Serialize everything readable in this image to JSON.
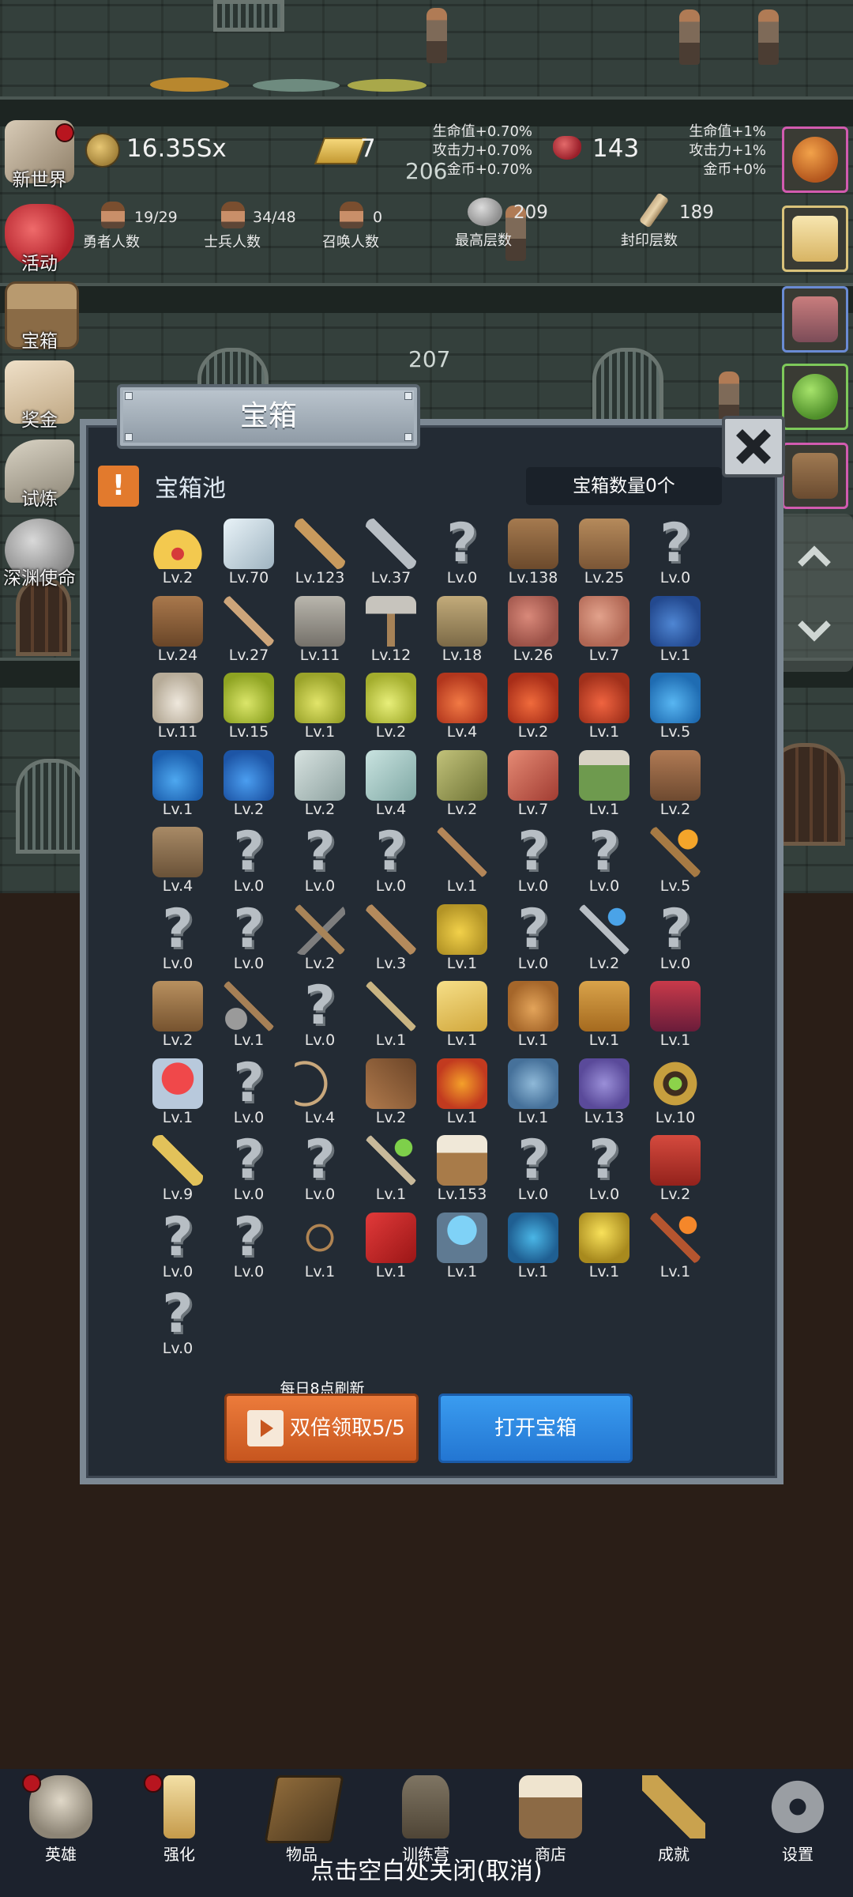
{
  "top_stats": {
    "coins": "16.35Sx",
    "gold_bars": "7",
    "rubies": "143",
    "bonus_left": [
      "生命值+0.70%",
      "攻击力+0.70%",
      "金币+0.70%"
    ],
    "bonus_right": [
      "生命值+1%",
      "攻击力+1%",
      "金币+0%"
    ],
    "heroes": {
      "value": "19/29",
      "label": "勇者人数"
    },
    "soldiers": {
      "value": "34/48",
      "label": "士兵人数"
    },
    "summons": {
      "value": "0",
      "label": "召唤人数"
    },
    "highest_floor": {
      "value": "209",
      "label": "最高层数"
    },
    "sealed_floor": {
      "value": "189",
      "label": "封印层数"
    }
  },
  "floor_numbers": [
    "206",
    "207"
  ],
  "sidebar": {
    "items": [
      {
        "label": "新世界",
        "badge": true
      },
      {
        "label": "活动",
        "badge": false
      },
      {
        "label": "宝箱",
        "badge": false
      },
      {
        "label": "奖金",
        "badge": false
      },
      {
        "label": "试炼",
        "badge": false
      },
      {
        "label": "深渊使命",
        "badge": false
      }
    ]
  },
  "modal": {
    "title": "宝箱",
    "pool_icon": "!",
    "pool_title": "宝箱池",
    "chest_count": "宝箱数量0个",
    "refresh_note": "每日8点刷新",
    "double_claim": "双倍领取5/5",
    "open_chest": "打开宝箱",
    "items": [
      {
        "icon": "crown",
        "lv": "Lv.2"
      },
      {
        "icon": "diamond",
        "lv": "Lv.70"
      },
      {
        "icon": "wood-sword",
        "lv": "Lv.123"
      },
      {
        "icon": "iron-sword",
        "lv": "Lv.37"
      },
      {
        "icon": "unknown",
        "lv": "Lv.0"
      },
      {
        "icon": "leather-armor",
        "lv": "Lv.138"
      },
      {
        "icon": "backpack",
        "lv": "Lv.25"
      },
      {
        "icon": "unknown",
        "lv": "Lv.0"
      },
      {
        "icon": "leather-helmet",
        "lv": "Lv.24"
      },
      {
        "icon": "dagger",
        "lv": "Lv.27"
      },
      {
        "icon": "knight-helmet",
        "lv": "Lv.11"
      },
      {
        "icon": "hammer",
        "lv": "Lv.12"
      },
      {
        "icon": "great-helm",
        "lv": "Lv.18"
      },
      {
        "icon": "ham",
        "lv": "Lv.26"
      },
      {
        "icon": "steak",
        "lv": "Lv.7"
      },
      {
        "icon": "blue-sack",
        "lv": "Lv.1"
      },
      {
        "icon": "flour",
        "lv": "Lv.11"
      },
      {
        "icon": "yellow-potion",
        "lv": "Lv.15"
      },
      {
        "icon": "yellow-flask",
        "lv": "Lv.1"
      },
      {
        "icon": "yellow-round-potion",
        "lv": "Lv.2"
      },
      {
        "icon": "red-potion",
        "lv": "Lv.4"
      },
      {
        "icon": "red-flask",
        "lv": "Lv.2"
      },
      {
        "icon": "red-round-potion",
        "lv": "Lv.1"
      },
      {
        "icon": "blue-potion",
        "lv": "Lv.5"
      },
      {
        "icon": "blue-flask",
        "lv": "Lv.1"
      },
      {
        "icon": "blue-round-potion",
        "lv": "Lv.2"
      },
      {
        "icon": "white-vial",
        "lv": "Lv.2"
      },
      {
        "icon": "clear-vial",
        "lv": "Lv.4"
      },
      {
        "icon": "green-bottle",
        "lv": "Lv.2"
      },
      {
        "icon": "red-bottle",
        "lv": "Lv.7"
      },
      {
        "icon": "winged-boot",
        "lv": "Lv.1"
      },
      {
        "icon": "leather-boot",
        "lv": "Lv.2"
      },
      {
        "icon": "shoe",
        "lv": "Lv.4"
      },
      {
        "icon": "unknown",
        "lv": "Lv.0"
      },
      {
        "icon": "unknown",
        "lv": "Lv.0"
      },
      {
        "icon": "unknown",
        "lv": "Lv.0"
      },
      {
        "icon": "stick",
        "lv": "Lv.1"
      },
      {
        "icon": "unknown",
        "lv": "Lv.0"
      },
      {
        "icon": "unknown",
        "lv": "Lv.0"
      },
      {
        "icon": "torch",
        "lv": "Lv.5"
      },
      {
        "icon": "unknown",
        "lv": "Lv.0"
      },
      {
        "icon": "unknown",
        "lv": "Lv.0"
      },
      {
        "icon": "pickaxe",
        "lv": "Lv.2"
      },
      {
        "icon": "staff",
        "lv": "Lv.3"
      },
      {
        "icon": "lemons",
        "lv": "Lv.1"
      },
      {
        "icon": "unknown",
        "lv": "Lv.0"
      },
      {
        "icon": "blue-wand",
        "lv": "Lv.2"
      },
      {
        "icon": "unknown",
        "lv": "Lv.0"
      },
      {
        "icon": "big-backpack",
        "lv": "Lv.2"
      },
      {
        "icon": "shovel",
        "lv": "Lv.1"
      },
      {
        "icon": "unknown",
        "lv": "Lv.0"
      },
      {
        "icon": "broom",
        "lv": "Lv.1"
      },
      {
        "icon": "cheese",
        "lv": "Lv.1"
      },
      {
        "icon": "pie",
        "lv": "Lv.1"
      },
      {
        "icon": "honey-jar",
        "lv": "Lv.1"
      },
      {
        "icon": "red-crystal",
        "lv": "Lv.1"
      },
      {
        "icon": "red-orb",
        "lv": "Lv.1"
      },
      {
        "icon": "unknown",
        "lv": "Lv.0"
      },
      {
        "icon": "bow",
        "lv": "Lv.4"
      },
      {
        "icon": "quiver",
        "lv": "Lv.2"
      },
      {
        "icon": "fire-scroll",
        "lv": "Lv.1"
      },
      {
        "icon": "blue-spirit",
        "lv": "Lv.1"
      },
      {
        "icon": "purple-spirit",
        "lv": "Lv.13"
      },
      {
        "icon": "green-eye-ring",
        "lv": "Lv.10"
      },
      {
        "icon": "gold-wand",
        "lv": "Lv.9"
      },
      {
        "icon": "unknown",
        "lv": "Lv.0"
      },
      {
        "icon": "unknown",
        "lv": "Lv.0"
      },
      {
        "icon": "green-wand",
        "lv": "Lv.1"
      },
      {
        "icon": "beer-mug",
        "lv": "Lv.153"
      },
      {
        "icon": "unknown",
        "lv": "Lv.0"
      },
      {
        "icon": "unknown",
        "lv": "Lv.0"
      },
      {
        "icon": "red-book",
        "lv": "Lv.2"
      },
      {
        "icon": "unknown",
        "lv": "Lv.0"
      },
      {
        "icon": "unknown",
        "lv": "Lv.0"
      },
      {
        "icon": "whip",
        "lv": "Lv.1"
      },
      {
        "icon": "red-banner",
        "lv": "Lv.1"
      },
      {
        "icon": "blue-crystal-ball",
        "lv": "Lv.1"
      },
      {
        "icon": "blue-rune",
        "lv": "Lv.1"
      },
      {
        "icon": "gold-orb",
        "lv": "Lv.1"
      },
      {
        "icon": "fire-staff",
        "lv": "Lv.1"
      },
      {
        "icon": "unknown",
        "lv": "Lv.0"
      }
    ]
  },
  "bottom_nav": {
    "items": [
      {
        "label": "英雄",
        "icon": "skull-icon",
        "badge": true
      },
      {
        "label": "强化",
        "icon": "candle-icon",
        "badge": true
      },
      {
        "label": "物品",
        "icon": "book-icon",
        "badge": false
      },
      {
        "label": "训练营",
        "icon": "lantern-icon",
        "badge": false
      },
      {
        "label": "商店",
        "icon": "mug-icon",
        "badge": false
      },
      {
        "label": "成就",
        "icon": "key-icon",
        "badge": false
      },
      {
        "label": "设置",
        "icon": "gear-icon",
        "badge": false
      }
    ],
    "close_hint": "点击空白处关闭(取消)"
  },
  "colors": {
    "modal_bg": "#232b34",
    "double_button": "#e2702f",
    "open_button": "#2f8ae6",
    "badge_red": "#b8151f"
  }
}
